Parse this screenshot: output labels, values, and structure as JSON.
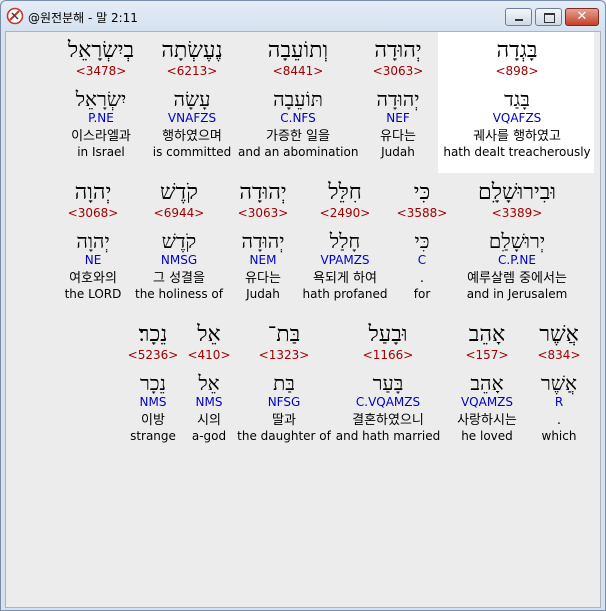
{
  "window": {
    "title": "@원전분해 - 말 2:11"
  },
  "icons": {
    "app": "logo-icon",
    "minimize": "minimize-icon",
    "maximize": "maximize-icon",
    "close": "close-icon"
  },
  "colors": {
    "strong": "#a00000",
    "morph": "#0000c8",
    "highlight": "#ffffff"
  },
  "rows": [
    {
      "words": [
        {
          "heb": "בָּגְדָה",
          "strong": "<898>",
          "lemma": "בָּגַד",
          "morph": "VQAFZS",
          "kor": "궤사를 행하였고",
          "eng": "hath dealt treacherously"
        },
        {
          "heb": "יְהוּדָה",
          "strong": "<3063>",
          "lemma": "יְהוּדָה",
          "morph": "NEF",
          "kor": "유다는",
          "eng": "Judah"
        },
        {
          "heb": "וְתוֹעֵבָה",
          "strong": "<8441>",
          "lemma": "תּוֹעֵבָה",
          "morph": "C.NFS",
          "kor": "가증한 일을",
          "eng": "and an abomination"
        },
        {
          "heb": "נֶעֶשְׂתָה",
          "strong": "<6213>",
          "lemma": "עָשָׂה",
          "morph": "VNAFZS",
          "kor": "행하였으며",
          "eng": "is committed"
        },
        {
          "heb": "בְיִשְׂרָאֵל",
          "strong": "<3478>",
          "lemma": "יִשְׂרָאֵל",
          "morph": "P.NE",
          "kor": "이스라엘과",
          "eng": "in Israel"
        }
      ]
    },
    {
      "words": [
        {
          "heb": "וּבִירוּשָׁלִָם",
          "strong": "<3389>",
          "lemma": "יְרוּשָׁלִַם",
          "morph": "C.P.NE",
          "kor": "예루살렘 중에서는",
          "eng": "and in Jerusalem"
        },
        {
          "heb": "כִּי",
          "strong": "<3588>",
          "lemma": "כִּי",
          "morph": "C",
          "kor": ".",
          "eng": "for"
        },
        {
          "heb": "חִלֵּל",
          "strong": "<2490>",
          "lemma": "חָלַל",
          "morph": "VPAMZS",
          "kor": "욕되게 하여",
          "eng": "hath profaned"
        },
        {
          "heb": "יְהוּדָה",
          "strong": "<3063>",
          "lemma": "יְהוּדָה",
          "morph": "NEM",
          "kor": "유다는",
          "eng": "Judah"
        },
        {
          "heb": "קֹדֶשׁ",
          "strong": "<6944>",
          "lemma": "קֹדֶשׁ",
          "morph": "NMSG",
          "kor": "그 성결을",
          "eng": "the holiness of"
        },
        {
          "heb": "יְהוָה",
          "strong": "<3068>",
          "lemma": "יְהוָה",
          "morph": "NE",
          "kor": "여호와의",
          "eng": "the LORD"
        }
      ]
    },
    {
      "words": [
        {
          "heb": "אֲשֶׁר",
          "strong": "<834>",
          "lemma": "אֲשֶׁר",
          "morph": "R",
          "kor": ".",
          "eng": "which"
        },
        {
          "heb": "אָהֵב",
          "strong": "<157>",
          "lemma": "אָהֵב",
          "morph": "VQAMZS",
          "kor": "사랑하시는",
          "eng": "he loved"
        },
        {
          "heb": "וּבָעַל",
          "strong": "<1166>",
          "lemma": "בָּעַר",
          "morph": "C.VQAMZS",
          "kor": "결혼하였으니",
          "eng": "and hath married"
        },
        {
          "heb": "בַּת־",
          "strong": "<1323>",
          "lemma": "בַּת",
          "morph": "NFSG",
          "kor": "딸과",
          "eng": "the daughter of"
        },
        {
          "heb": "אֵל",
          "strong": "<410>",
          "lemma": "אֵל",
          "morph": "NMS",
          "kor": "시의",
          "eng": "a-god"
        },
        {
          "heb": "נֵכָר׃",
          "strong": "<5236>",
          "lemma": "נֵכָר",
          "morph": "NMS",
          "kor": "이방",
          "eng": "strange"
        }
      ]
    }
  ]
}
